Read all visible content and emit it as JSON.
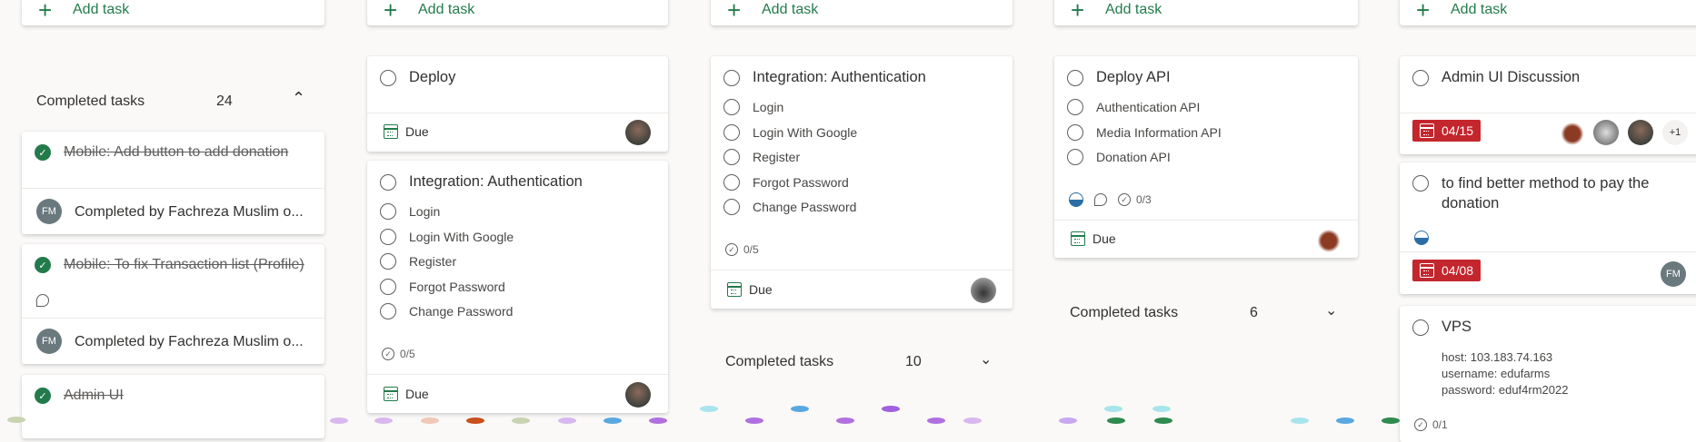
{
  "add_task_label": "Add task",
  "columns": [
    {
      "completed": {
        "label": "Completed tasks",
        "count": "24",
        "chevron": "chevron-up-icon"
      },
      "completed_tasks": [
        {
          "title": "Mobile: Add button to add donation",
          "completed_by": "Completed by Fachreza Muslim o...",
          "initials": "FM"
        },
        {
          "title": "Mobile: To fix Transaction list (Profile)",
          "completed_by": "Completed by Fachreza Muslim o...",
          "initials": "FM"
        },
        {
          "title": "Admin UI"
        }
      ]
    },
    {
      "tasks": [
        {
          "title": "Deploy",
          "due": "Due"
        },
        {
          "title": "Integration: Authentication",
          "items": [
            "Login",
            "Login With Google",
            "Register",
            "Forgot Password",
            "Change Password"
          ],
          "checklist": "0/5",
          "due": "Due"
        }
      ]
    },
    {
      "tasks": [
        {
          "title": "Integration: Authentication",
          "items": [
            "Login",
            "Login With Google",
            "Register",
            "Forgot Password",
            "Change Password"
          ],
          "checklist": "0/5",
          "due": "Due"
        }
      ],
      "completed": {
        "label": "Completed tasks",
        "count": "10",
        "chevron": "chevron-down-icon"
      }
    },
    {
      "tasks": [
        {
          "title": "Deploy API",
          "items": [
            "Authentication API",
            "Media Information API",
            "Donation API"
          ],
          "checklist": "0/3",
          "due": "Due"
        }
      ],
      "completed": {
        "label": "Completed tasks",
        "count": "6",
        "chevron": "chevron-down-icon"
      }
    },
    {
      "tasks": [
        {
          "title": "Admin UI Discussion",
          "due": "04/15",
          "extra_assignees": "+1"
        },
        {
          "title": "to find better method to pay the donation",
          "due": "04/08",
          "initials": "FM"
        },
        {
          "title": "VPS",
          "notes": [
            "host: 103.183.74.163",
            "username: edufarms",
            "password: eduf4rm2022"
          ],
          "checklist": "0/1"
        }
      ]
    }
  ],
  "colors": {
    "accent": "#237b4b",
    "late": "#c4262e",
    "progress": "#2b6ea5"
  }
}
